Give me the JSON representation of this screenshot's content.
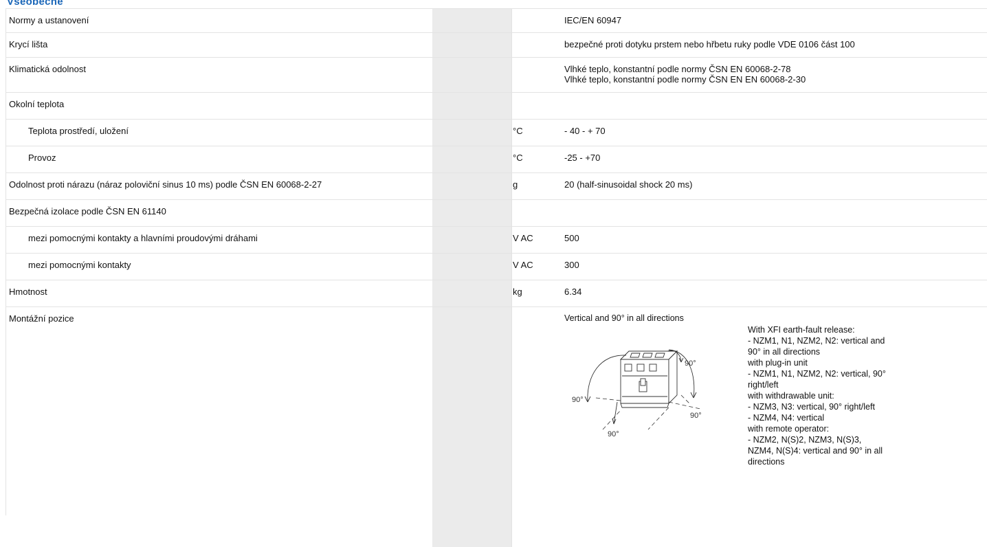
{
  "section": {
    "heading": "Všeobecně"
  },
  "rows": {
    "norms": {
      "label": "Normy a ustanovení",
      "unit": "",
      "value": "IEC/EN 60947"
    },
    "cover": {
      "label": "Krycí lišta",
      "unit": "",
      "value": "bezpečné proti dotyku prstem nebo hřbetu ruky podle VDE 0106 část 100"
    },
    "climate": {
      "label": "Klimatická odolnost",
      "unit": "",
      "values": [
        "Vlhké teplo, konstantní podle normy ČSN EN 60068-2-78",
        "Vlhké teplo, konstantní podle normy ČSN EN EN 60068-2-30"
      ]
    },
    "ambient": {
      "label": "Okolní teplota",
      "unit": "",
      "value": ""
    },
    "ambient_storage": {
      "label": "Teplota prostředí, uložení",
      "unit": "°C",
      "value": "- 40 - + 70"
    },
    "ambient_operation": {
      "label": "Provoz",
      "unit": "°C",
      "value": "-25 - +70"
    },
    "shock": {
      "label": "Odolnost proti nárazu (náraz poloviční sinus 10 ms) podle ČSN EN 60068-2-27",
      "unit": "g",
      "value": "20 (half-sinusoidal shock 20 ms)"
    },
    "isolation": {
      "label": "Bezpečná izolace podle ČSN EN 61140",
      "unit": "",
      "value": ""
    },
    "isolation_main": {
      "label": "mezi pomocnými kontakty a hlavními proudovými dráhami",
      "unit": "V AC",
      "value": "500"
    },
    "isolation_aux": {
      "label": "mezi pomocnými kontakty",
      "unit": "V AC",
      "value": "300"
    },
    "weight": {
      "label": "Hmotnost",
      "unit": "kg",
      "value": "6.34"
    },
    "mounting": {
      "label": "Montážní pozice",
      "unit": "",
      "title": "Vertical and 90° in all directions",
      "figure_labels": [
        "90°",
        "90°",
        "90°",
        "90°"
      ],
      "notes": [
        "With XFI earth-fault release:",
        "- NZM1, N1, NZM2, N2: vertical and",
        "90° in all directions",
        "with plug-in unit",
        "- NZM1, N1, NZM2, N2: vertical, 90°",
        "right/left",
        "with withdrawable unit:",
        "- NZM3, N3: vertical, 90° right/left",
        "- NZM4, N4: vertical",
        "with remote operator:",
        "- NZM2, N(S)2, NZM3, N(S)3,",
        "NZM4, N(S)4: vertical and 90° in all",
        "directions"
      ]
    }
  },
  "colors": {
    "heading": "#1a66b8",
    "shade": "#ebebeb",
    "rule": "#e3e3e3"
  }
}
